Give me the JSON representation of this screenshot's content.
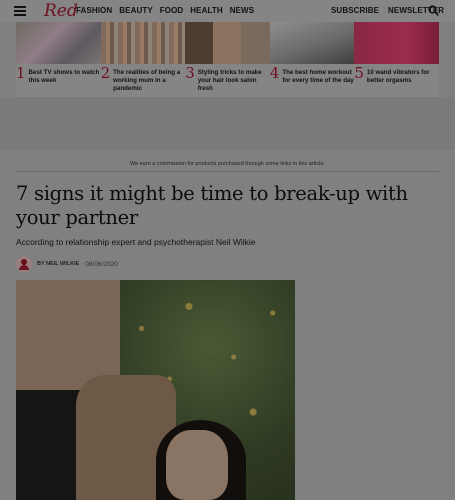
{
  "header": {
    "logo": "Red",
    "nav": [
      "FASHION",
      "BEAUTY",
      "FOOD",
      "HEALTH",
      "NEWS"
    ],
    "right": [
      "SUBSCRIBE",
      "NEWSLETTER"
    ]
  },
  "carousel": [
    {
      "num": "1",
      "text": "Best TV shows to watch this week"
    },
    {
      "num": "2",
      "text": "The realities of being a working mum in a pandemic"
    },
    {
      "num": "3",
      "text": "Styling tricks to make your hair look salon fresh"
    },
    {
      "num": "4",
      "text": "The best home workout for every time of the day"
    },
    {
      "num": "5",
      "text": "10 wand vibrators for better orgasms"
    }
  ],
  "article": {
    "disclaimer": "We earn a commission for products purchased through some links in this article.",
    "headline": "7 signs it might be time to break-up with your partner",
    "standfirst": "According to relationship expert and psychotherapist Neil Wilkie",
    "byline": "BY NEIL WILKIE",
    "date": "08/06/2020"
  },
  "colors": {
    "brand": "#6e1020"
  }
}
